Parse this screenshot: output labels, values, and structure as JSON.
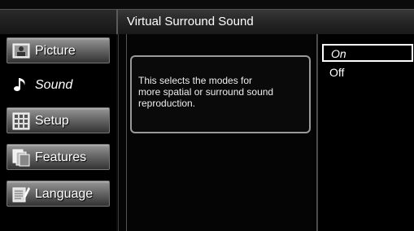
{
  "header": {
    "title": "Virtual Surround Sound"
  },
  "menu": {
    "items": [
      {
        "label": "Picture",
        "icon": "picture-icon"
      },
      {
        "label": "Sound",
        "icon": "music-note-icon",
        "selected": true
      },
      {
        "label": "Setup",
        "icon": "setup-grid-icon"
      },
      {
        "label": "Features",
        "icon": "features-icon"
      },
      {
        "label": "Language",
        "icon": "language-icon"
      }
    ]
  },
  "description": {
    "line1": "This selects the modes for",
    "line2": "more spatial or surround sound",
    "line3": "reproduction."
  },
  "options": [
    {
      "label": "On",
      "selected": true
    },
    {
      "label": "Off",
      "selected": false
    }
  ]
}
